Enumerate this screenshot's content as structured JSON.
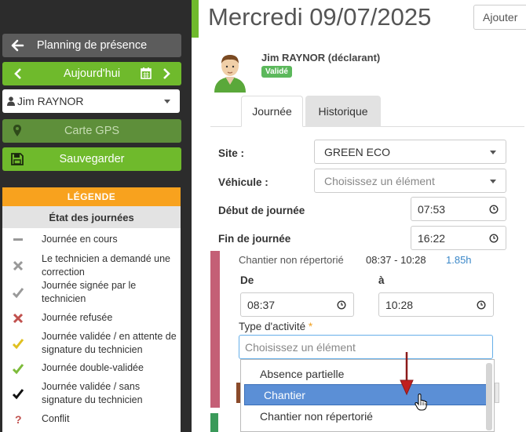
{
  "sidebar": {
    "planning_label": "Planning de présence",
    "today_label": "Aujourd'hui",
    "user_value": "Jim RAYNOR",
    "gps_label": "Carte GPS",
    "save_label": "Sauvegarder",
    "legend": {
      "title": "LÉGENDE",
      "subtitle": "État des journées",
      "items": [
        {
          "icon": "dash-icon",
          "text": "Journée en cours"
        },
        {
          "icon": "cross-gray-icon",
          "text": "Le technicien a demandé une correction"
        },
        {
          "icon": "check-gray-icon",
          "text": "Journée signée par le technicien"
        },
        {
          "icon": "cross-red-icon",
          "text": "Journée refusée"
        },
        {
          "icon": "check-yellow-icon",
          "text": "Journée validée / en attente de signature du technicien"
        },
        {
          "icon": "check-green-icon",
          "text": "Journée double-validée"
        },
        {
          "icon": "check-black-icon",
          "text": "Journée validée / sans signature du technicien"
        },
        {
          "icon": "question-icon",
          "text": "Conflit"
        }
      ]
    }
  },
  "header": {
    "date_title": "Mercredi 09/07/2025",
    "add_button": "Ajouter"
  },
  "user": {
    "name": "Jim RAYNOR (déclarant)",
    "status_badge": "Validé"
  },
  "tabs": [
    {
      "label": "Journée",
      "active": true
    },
    {
      "label": "Historique",
      "active": false
    }
  ],
  "form": {
    "site_label": "Site :",
    "site_value": "GREEN ECO",
    "vehicle_label": "Véhicule :",
    "vehicle_placeholder": "Choisissez un élément",
    "start_label": "Début de journée",
    "start_value": "07:53",
    "end_label": "Fin de journée",
    "end_value": "16:22"
  },
  "activity": {
    "title": "Chantier non répertorié",
    "time_range": "08:37 - 10:28",
    "duration": "1.85h",
    "from_label": "De",
    "from_value": "08:37",
    "to_label": "à",
    "to_value": "10:28",
    "type_label": "Type d'activité",
    "required_mark": "*",
    "type_placeholder": "Choisissez un élément",
    "options": [
      "Absence partielle",
      "Chantier",
      "Chantier non répertorié"
    ],
    "selected_option": "Chantier"
  },
  "colors": {
    "sidebar_bg": "#2c2c2c",
    "accent_green": "#6fba2c",
    "legend_orange": "#f8a21e",
    "card_border": "#c45f76",
    "highlight_blue": "#5b8fd6"
  }
}
